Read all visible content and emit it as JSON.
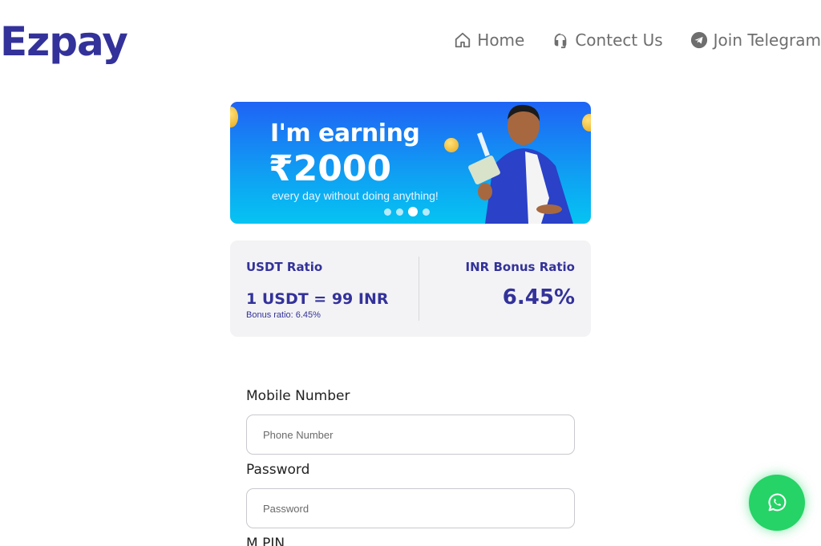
{
  "header": {
    "logo": "Ezpay",
    "nav": [
      {
        "label": "Home",
        "icon": "home-icon"
      },
      {
        "label": "Contect Us",
        "icon": "headset-icon"
      },
      {
        "label": "Join Telegram",
        "icon": "telegram-icon"
      }
    ]
  },
  "banner": {
    "title": "I'm earning",
    "amount": "₹2000",
    "subtitle": "every day without doing anything!",
    "slide_count": 4,
    "active_slide": 3
  },
  "ratios": {
    "usdt": {
      "label": "USDT Ratio",
      "value": "1 USDT = 99 INR",
      "note": "Bonus ratio: 6.45%"
    },
    "inr": {
      "label": "INR Bonus Ratio",
      "value": "6.45%"
    }
  },
  "form": {
    "mobile": {
      "label": "Mobile Number",
      "placeholder": "Phone Number",
      "value": ""
    },
    "password": {
      "label": "Password",
      "placeholder": "Password",
      "value": ""
    },
    "mpin": {
      "label": "M PIN"
    }
  },
  "colors": {
    "brand": "#33329a",
    "banner_top": "#1f63f5",
    "banner_bottom": "#05c4f2",
    "whatsapp": "#25d366"
  },
  "whatsapp": {
    "icon": "whatsapp-icon"
  }
}
